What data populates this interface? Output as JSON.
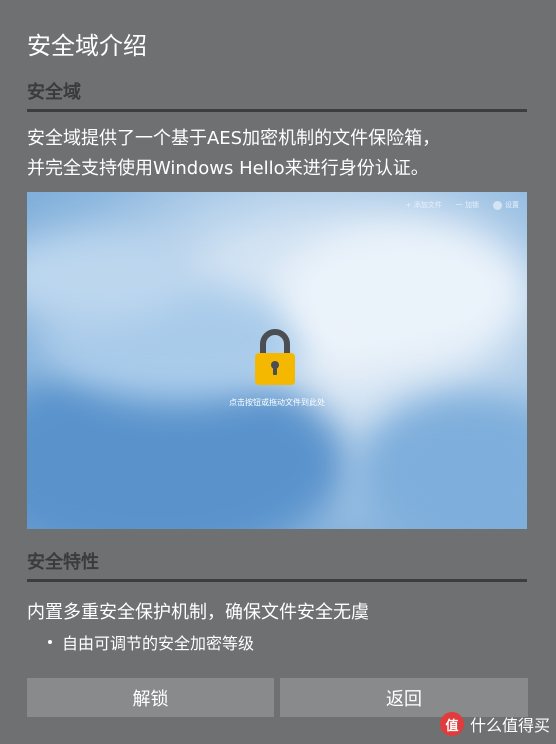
{
  "dialog": {
    "title": "安全域介绍",
    "section1": {
      "heading": "安全域",
      "description_line1": "安全域提供了一个基于AES加密机制的文件保险箱，",
      "description_line2": "并完全支持使用Windows Hello来进行身份认证。"
    },
    "preview": {
      "toolbar": [
        "+ 添加文件",
        "一 加锁",
        "设置"
      ],
      "hint": "点击按钮或拖动文件到此处",
      "lock_color": "#f5b800"
    },
    "section2": {
      "heading": "安全特性",
      "text": "内置多重安全保护机制，确保文件安全无虞",
      "bullets": [
        "自由可调节的安全加密等级"
      ]
    },
    "buttons": {
      "unlock": "解锁",
      "back": "返回"
    },
    "watermark": {
      "badge": "值",
      "text": "什么值得买"
    }
  }
}
